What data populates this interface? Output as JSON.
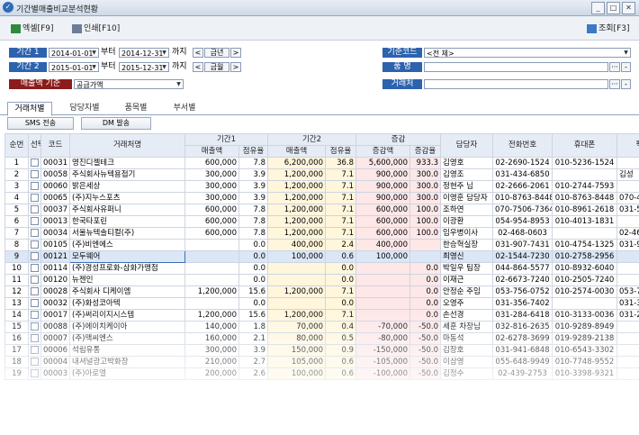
{
  "window": {
    "title": "기간별매출비교분석현황"
  },
  "toolbar": {
    "excel": "엑셀[F9]",
    "print": "인쇄[F10]",
    "query": "조회[F3]"
  },
  "filters": {
    "period1": {
      "label": "기간 1",
      "from": "2014-01-01",
      "sep": "부터",
      "to": "2014-12-31",
      "until": "까지",
      "this_year": "금년"
    },
    "period2": {
      "label": "기간 2",
      "from": "2015-01-01",
      "sep": "부터",
      "to": "2015-12-31",
      "until": "까지",
      "this_month": "금월"
    },
    "basis": {
      "label": "매출액 기준",
      "value": "공급가액"
    },
    "basecode": {
      "label": "기준코드",
      "value": "<전 체>"
    },
    "product": {
      "label": "품 명",
      "value": ""
    },
    "client": {
      "label": "거래처",
      "value": ""
    },
    "prev": "<",
    "next": ">",
    "more": "···",
    "minus": "-"
  },
  "tabs": [
    "거래처별",
    "담당자별",
    "품목별",
    "부서별"
  ],
  "actions": {
    "sms": "SMS 전송",
    "dm": "DM 발송"
  },
  "grid": {
    "headers": {
      "seq": "순번",
      "sel": "선택",
      "code": "코드",
      "name": "거래처명",
      "p1": "기간1",
      "p2": "기간2",
      "diff": "증감",
      "sales": "매출액",
      "share": "점유율",
      "amount": "증감액",
      "rate": "증감율",
      "rep": "담당자",
      "phone": "전화번호",
      "mobile": "휴대폰",
      "extra": "팩"
    },
    "rows": [
      [
        "1",
        "00031",
        "영진디젤테크",
        "600,000",
        "7.8",
        "6,200,000",
        "36.8",
        "5,600,000",
        "933.3",
        "김영호",
        "02-2690-1524",
        "010-5236-1524",
        ""
      ],
      [
        "2",
        "00058",
        "주식회사뉴텍용접기",
        "300,000",
        "3.9",
        "1,200,000",
        "7.1",
        "900,000",
        "300.0",
        "김영조",
        "031-434-6850",
        "",
        "김성"
      ],
      [
        "3",
        "00060",
        "밝은세상",
        "300,000",
        "3.9",
        "1,200,000",
        "7.1",
        "900,000",
        "300.0",
        "정현주 님",
        "02-2666-2061",
        "010-2744-7593",
        ""
      ],
      [
        "4",
        "00065",
        "(주)지누스포츠",
        "300,000",
        "3.9",
        "1,200,000",
        "7.1",
        "900,000",
        "300.0",
        "이영훈 담당자",
        "010-8763-8448",
        "010-8763-8448",
        "070-434"
      ],
      [
        "5",
        "00037",
        "주식회사유퍼니",
        "600,000",
        "7.8",
        "1,200,000",
        "7.1",
        "600,000",
        "100.0",
        "조하연",
        "070-7506-7364",
        "010-8961-2618",
        "031-541"
      ],
      [
        "6",
        "00013",
        "한국타포린",
        "600,000",
        "7.8",
        "1,200,000",
        "7.1",
        "600,000",
        "100.0",
        "이광환",
        "054-954-8953",
        "010-4013-1831",
        ""
      ],
      [
        "7",
        "00034",
        "서울뉴텍솔티컬(주)",
        "600,000",
        "7.8",
        "1,200,000",
        "7.1",
        "600,000",
        "100.0",
        "임우병이사",
        "02-468-0603",
        "",
        "02-468"
      ],
      [
        "8",
        "00105",
        "(주)비엔에스",
        "",
        "0.0",
        "400,000",
        "2.4",
        "400,000",
        "",
        "한승혁실장",
        "031-907-7431",
        "010-4754-1325",
        "031-908"
      ],
      [
        "9",
        "00121",
        "모두웨어",
        "",
        "0.0",
        "100,000",
        "0.6",
        "100,000",
        "",
        "최영신",
        "02-1544-7230",
        "010-2758-2956",
        ""
      ],
      [
        "10",
        "00114",
        "(주)경성프로화-삼화가맹점",
        "",
        "0.0",
        "",
        "0.0",
        "",
        "0.0",
        "박일우 팀장",
        "044-864-5577",
        "010-8932-6040",
        ""
      ],
      [
        "11",
        "00120",
        "뉴젠인",
        "",
        "0.0",
        "",
        "0.0",
        "",
        "0.0",
        "이재근",
        "02-6673-7240",
        "010-2505-7240",
        ""
      ],
      [
        "12",
        "00028",
        "주식회사 디케이엠",
        "1,200,000",
        "15.6",
        "1,200,000",
        "7.1",
        "",
        "0.0",
        "안정순 주임",
        "053-756-0752",
        "010-2574-0030",
        "053-743"
      ],
      [
        "13",
        "00032",
        "(주)화성코아텍",
        "",
        "0.0",
        "",
        "0.0",
        "",
        "0.0",
        "오영주",
        "031-356-7402",
        "",
        "031-356"
      ],
      [
        "14",
        "00017",
        "(주)써리이지시스템",
        "1,200,000",
        "15.6",
        "1,200,000",
        "7.1",
        "",
        "0.0",
        "손선경",
        "031-284-6418",
        "010-3133-0036",
        "031-284"
      ],
      [
        "15",
        "00088",
        "(주)에이치케이아",
        "140,000",
        "1.8",
        "70,000",
        "0.4",
        "-70,000",
        "-50.0",
        "세훈 차장님",
        "032-816-2635",
        "010-9289-8949",
        ""
      ],
      [
        "16",
        "00007",
        "(주)맥씨엔스",
        "160,000",
        "2.1",
        "80,000",
        "0.5",
        "-80,000",
        "-50.0",
        "마동석",
        "02-6278-3699",
        "019-9289-2138",
        ""
      ],
      [
        "17",
        "00006",
        "석림유통",
        "300,000",
        "3.9",
        "150,000",
        "0.9",
        "-150,000",
        "-50.0",
        "김장호",
        "031-941-6848",
        "010-6543-3302",
        ""
      ],
      [
        "18",
        "00004",
        "내셔널광고박화장",
        "210,000",
        "2.7",
        "105,000",
        "0.6",
        "-105,000",
        "-50.0",
        "이삼영",
        "055-648-9949",
        "010-7748-9552",
        ""
      ],
      [
        "19",
        "00003",
        "(주)아로엘",
        "200,000",
        "2.6",
        "100,000",
        "0.6",
        "-100,000",
        "-50.0",
        "김정수",
        "02-439-2753",
        "010-3398-9321",
        ""
      ]
    ]
  }
}
